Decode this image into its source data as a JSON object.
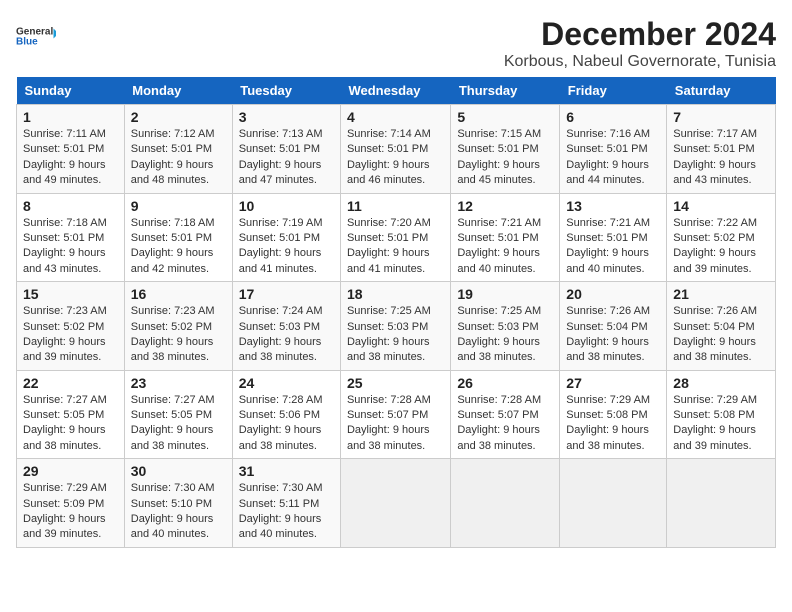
{
  "logo": {
    "line1": "General",
    "line2": "Blue"
  },
  "title": "December 2024",
  "subtitle": "Korbous, Nabeul Governorate, Tunisia",
  "calendar": {
    "headers": [
      "Sunday",
      "Monday",
      "Tuesday",
      "Wednesday",
      "Thursday",
      "Friday",
      "Saturday"
    ],
    "rows": [
      [
        {
          "day": "1",
          "lines": [
            "Sunrise: 7:11 AM",
            "Sunset: 5:01 PM",
            "Daylight: 9 hours",
            "and 49 minutes."
          ]
        },
        {
          "day": "2",
          "lines": [
            "Sunrise: 7:12 AM",
            "Sunset: 5:01 PM",
            "Daylight: 9 hours",
            "and 48 minutes."
          ]
        },
        {
          "day": "3",
          "lines": [
            "Sunrise: 7:13 AM",
            "Sunset: 5:01 PM",
            "Daylight: 9 hours",
            "and 47 minutes."
          ]
        },
        {
          "day": "4",
          "lines": [
            "Sunrise: 7:14 AM",
            "Sunset: 5:01 PM",
            "Daylight: 9 hours",
            "and 46 minutes."
          ]
        },
        {
          "day": "5",
          "lines": [
            "Sunrise: 7:15 AM",
            "Sunset: 5:01 PM",
            "Daylight: 9 hours",
            "and 45 minutes."
          ]
        },
        {
          "day": "6",
          "lines": [
            "Sunrise: 7:16 AM",
            "Sunset: 5:01 PM",
            "Daylight: 9 hours",
            "and 44 minutes."
          ]
        },
        {
          "day": "7",
          "lines": [
            "Sunrise: 7:17 AM",
            "Sunset: 5:01 PM",
            "Daylight: 9 hours",
            "and 43 minutes."
          ]
        }
      ],
      [
        {
          "day": "8",
          "lines": [
            "Sunrise: 7:18 AM",
            "Sunset: 5:01 PM",
            "Daylight: 9 hours",
            "and 43 minutes."
          ]
        },
        {
          "day": "9",
          "lines": [
            "Sunrise: 7:18 AM",
            "Sunset: 5:01 PM",
            "Daylight: 9 hours",
            "and 42 minutes."
          ]
        },
        {
          "day": "10",
          "lines": [
            "Sunrise: 7:19 AM",
            "Sunset: 5:01 PM",
            "Daylight: 9 hours",
            "and 41 minutes."
          ]
        },
        {
          "day": "11",
          "lines": [
            "Sunrise: 7:20 AM",
            "Sunset: 5:01 PM",
            "Daylight: 9 hours",
            "and 41 minutes."
          ]
        },
        {
          "day": "12",
          "lines": [
            "Sunrise: 7:21 AM",
            "Sunset: 5:01 PM",
            "Daylight: 9 hours",
            "and 40 minutes."
          ]
        },
        {
          "day": "13",
          "lines": [
            "Sunrise: 7:21 AM",
            "Sunset: 5:01 PM",
            "Daylight: 9 hours",
            "and 40 minutes."
          ]
        },
        {
          "day": "14",
          "lines": [
            "Sunrise: 7:22 AM",
            "Sunset: 5:02 PM",
            "Daylight: 9 hours",
            "and 39 minutes."
          ]
        }
      ],
      [
        {
          "day": "15",
          "lines": [
            "Sunrise: 7:23 AM",
            "Sunset: 5:02 PM",
            "Daylight: 9 hours",
            "and 39 minutes."
          ]
        },
        {
          "day": "16",
          "lines": [
            "Sunrise: 7:23 AM",
            "Sunset: 5:02 PM",
            "Daylight: 9 hours",
            "and 38 minutes."
          ]
        },
        {
          "day": "17",
          "lines": [
            "Sunrise: 7:24 AM",
            "Sunset: 5:03 PM",
            "Daylight: 9 hours",
            "and 38 minutes."
          ]
        },
        {
          "day": "18",
          "lines": [
            "Sunrise: 7:25 AM",
            "Sunset: 5:03 PM",
            "Daylight: 9 hours",
            "and 38 minutes."
          ]
        },
        {
          "day": "19",
          "lines": [
            "Sunrise: 7:25 AM",
            "Sunset: 5:03 PM",
            "Daylight: 9 hours",
            "and 38 minutes."
          ]
        },
        {
          "day": "20",
          "lines": [
            "Sunrise: 7:26 AM",
            "Sunset: 5:04 PM",
            "Daylight: 9 hours",
            "and 38 minutes."
          ]
        },
        {
          "day": "21",
          "lines": [
            "Sunrise: 7:26 AM",
            "Sunset: 5:04 PM",
            "Daylight: 9 hours",
            "and 38 minutes."
          ]
        }
      ],
      [
        {
          "day": "22",
          "lines": [
            "Sunrise: 7:27 AM",
            "Sunset: 5:05 PM",
            "Daylight: 9 hours",
            "and 38 minutes."
          ]
        },
        {
          "day": "23",
          "lines": [
            "Sunrise: 7:27 AM",
            "Sunset: 5:05 PM",
            "Daylight: 9 hours",
            "and 38 minutes."
          ]
        },
        {
          "day": "24",
          "lines": [
            "Sunrise: 7:28 AM",
            "Sunset: 5:06 PM",
            "Daylight: 9 hours",
            "and 38 minutes."
          ]
        },
        {
          "day": "25",
          "lines": [
            "Sunrise: 7:28 AM",
            "Sunset: 5:07 PM",
            "Daylight: 9 hours",
            "and 38 minutes."
          ]
        },
        {
          "day": "26",
          "lines": [
            "Sunrise: 7:28 AM",
            "Sunset: 5:07 PM",
            "Daylight: 9 hours",
            "and 38 minutes."
          ]
        },
        {
          "day": "27",
          "lines": [
            "Sunrise: 7:29 AM",
            "Sunset: 5:08 PM",
            "Daylight: 9 hours",
            "and 38 minutes."
          ]
        },
        {
          "day": "28",
          "lines": [
            "Sunrise: 7:29 AM",
            "Sunset: 5:08 PM",
            "Daylight: 9 hours",
            "and 39 minutes."
          ]
        }
      ],
      [
        {
          "day": "29",
          "lines": [
            "Sunrise: 7:29 AM",
            "Sunset: 5:09 PM",
            "Daylight: 9 hours",
            "and 39 minutes."
          ]
        },
        {
          "day": "30",
          "lines": [
            "Sunrise: 7:30 AM",
            "Sunset: 5:10 PM",
            "Daylight: 9 hours",
            "and 40 minutes."
          ]
        },
        {
          "day": "31",
          "lines": [
            "Sunrise: 7:30 AM",
            "Sunset: 5:11 PM",
            "Daylight: 9 hours",
            "and 40 minutes."
          ]
        },
        null,
        null,
        null,
        null
      ]
    ]
  }
}
